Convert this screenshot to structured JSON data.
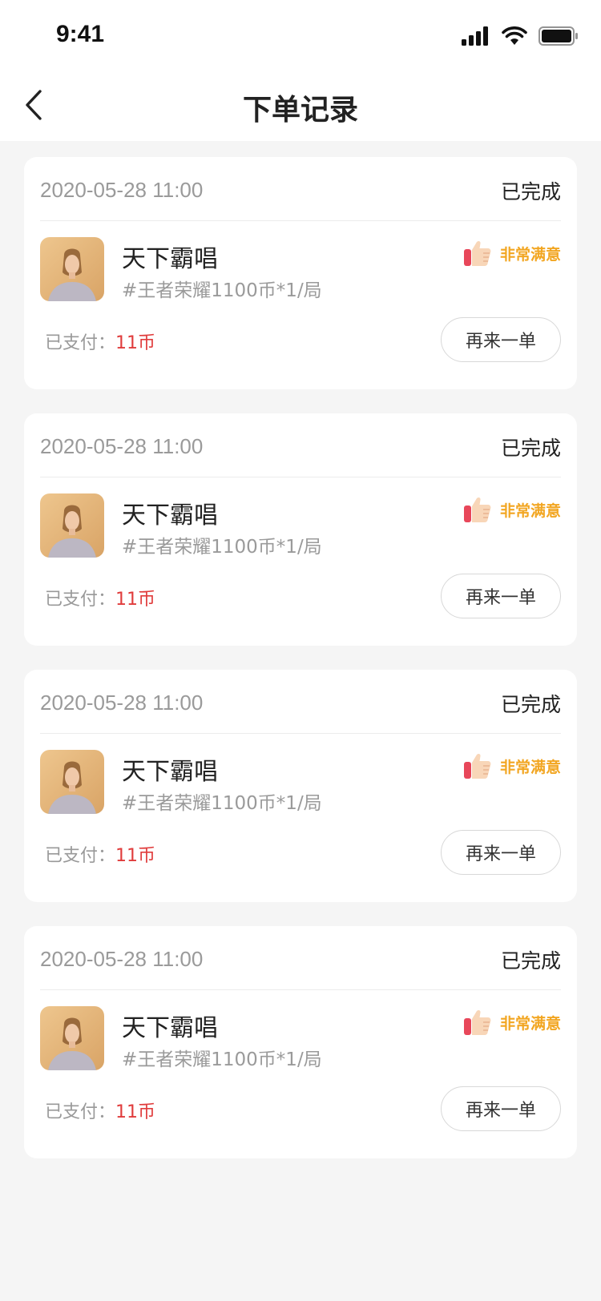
{
  "status_bar": {
    "time": "9:41"
  },
  "nav": {
    "title": "下单记录"
  },
  "orders": [
    {
      "date": "2020-05-28  11:00",
      "status": "已完成",
      "shop": "天下霸唱",
      "sku": "#王者荣耀1100币*1/局",
      "rating": "非常满意",
      "paid_label": "已支付：",
      "paid_amount": "11币",
      "reorder": "再来一单"
    },
    {
      "date": "2020-05-28  11:00",
      "status": "已完成",
      "shop": "天下霸唱",
      "sku": "#王者荣耀1100币*1/局",
      "rating": "非常满意",
      "paid_label": "已支付：",
      "paid_amount": "11币",
      "reorder": "再来一单"
    },
    {
      "date": "2020-05-28  11:00",
      "status": "已完成",
      "shop": "天下霸唱",
      "sku": "#王者荣耀1100币*1/局",
      "rating": "非常满意",
      "paid_label": "已支付：",
      "paid_amount": "11币",
      "reorder": "再来一单"
    },
    {
      "date": "2020-05-28  11:00",
      "status": "已完成",
      "shop": "天下霸唱",
      "sku": "#王者荣耀1100币*1/局",
      "rating": "非常满意",
      "paid_label": "已支付：",
      "paid_amount": "11币",
      "reorder": "再来一单"
    }
  ],
  "icons": {
    "back": "chevron-left-icon",
    "signal": "cellular-signal-icon",
    "wifi": "wifi-icon",
    "battery": "battery-icon",
    "rating": "thumbs-up-icon"
  },
  "colors": {
    "background": "#f5f5f5",
    "accent_price": "#e03c3c",
    "rating_text": "#f2a622",
    "thumb_cuff": "#e8475a",
    "thumb_hand": "#f8d6b8"
  }
}
